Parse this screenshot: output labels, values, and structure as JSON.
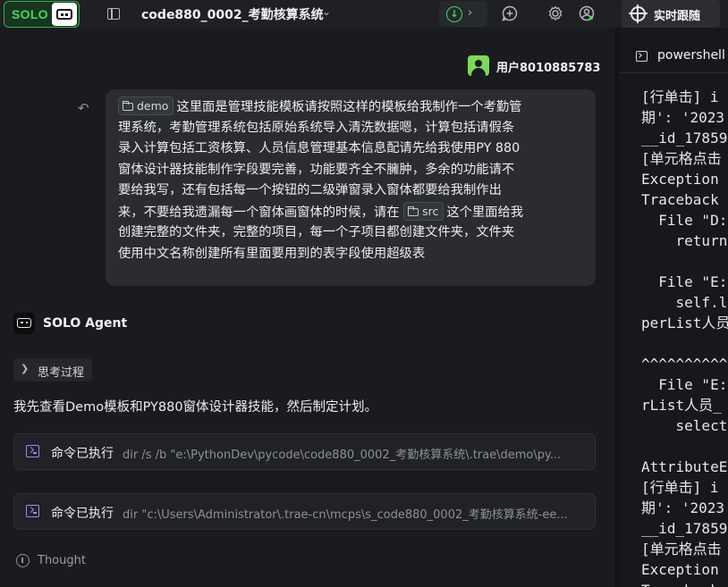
{
  "topbar": {
    "solo_label": "SOLO",
    "project_title": "code880_0002_考勤核算系统",
    "live_follow_label": "实时跟随"
  },
  "user": {
    "name": "用户8010885783"
  },
  "user_message": {
    "chip_demo": "demo",
    "chip_src": "src",
    "lines": [
      "这里面是管理技能模板请按照这样的模板给我制作一个考勤管",
      "理系统，考勤管理系统包括原始系统导入清洗数据嗯，计算包括请假条",
      "录入计算包括工资核算、人员信息管理基本信息配请先给我使用PY 880",
      "窗体设计器技能制作字段要完善，功能要齐全不臃肿，多余的功能请不",
      "要给我写，还有包括每一个按钮的二级弹窗录入窗体都要给我制作出",
      "来，不要给我遗漏每一个窗体画窗体的时候，请在",
      "这个里面给我",
      "创建完整的文件夹，完整的项目，每一个子项目都创建文件夹，文件夹",
      "使用中文名称创建所有里面要用到的表字段使用超级表"
    ]
  },
  "agent": {
    "name": "SOLO Agent",
    "thinking_label": "思考过程",
    "response_text": "我先查看Demo模板和PY880窗体设计器技能，然后制定计划。",
    "commands": [
      {
        "status": "命令已执行",
        "command": "dir /s /b \"e:\\PythonDev\\pycode\\code880_0002_考勤核算系统\\.trae\\demo\\py..."
      },
      {
        "status": "命令已执行",
        "command": "dir \"c:\\Users\\Administrator\\.trae-cn\\mcps\\s_code880_0002_考勤核算系统-ee..."
      }
    ],
    "thought_label": "Thought"
  },
  "terminal": {
    "tab_label": "powershell",
    "lines": [
      "[行单击] i",
      "期': '2023",
      "__id_17859",
      "[单元格点击",
      "Exception",
      "Traceback",
      "  File \"D:",
      "    return",
      "",
      "  File \"E:",
      "    self.l",
      "perList人员",
      "",
      "^^^^^^^^^^",
      "  File \"E:",
      "rList人员_",
      "    select",
      "",
      "AttributeE",
      "[行单击] i",
      "期': '2023",
      "__id_17859",
      "[单元格点击",
      "Exception",
      "Traceback"
    ]
  },
  "colors": {
    "accent_green": "#3ddc5d",
    "terminal_icon": "#9c8df0",
    "background": "#1a1b1e"
  }
}
